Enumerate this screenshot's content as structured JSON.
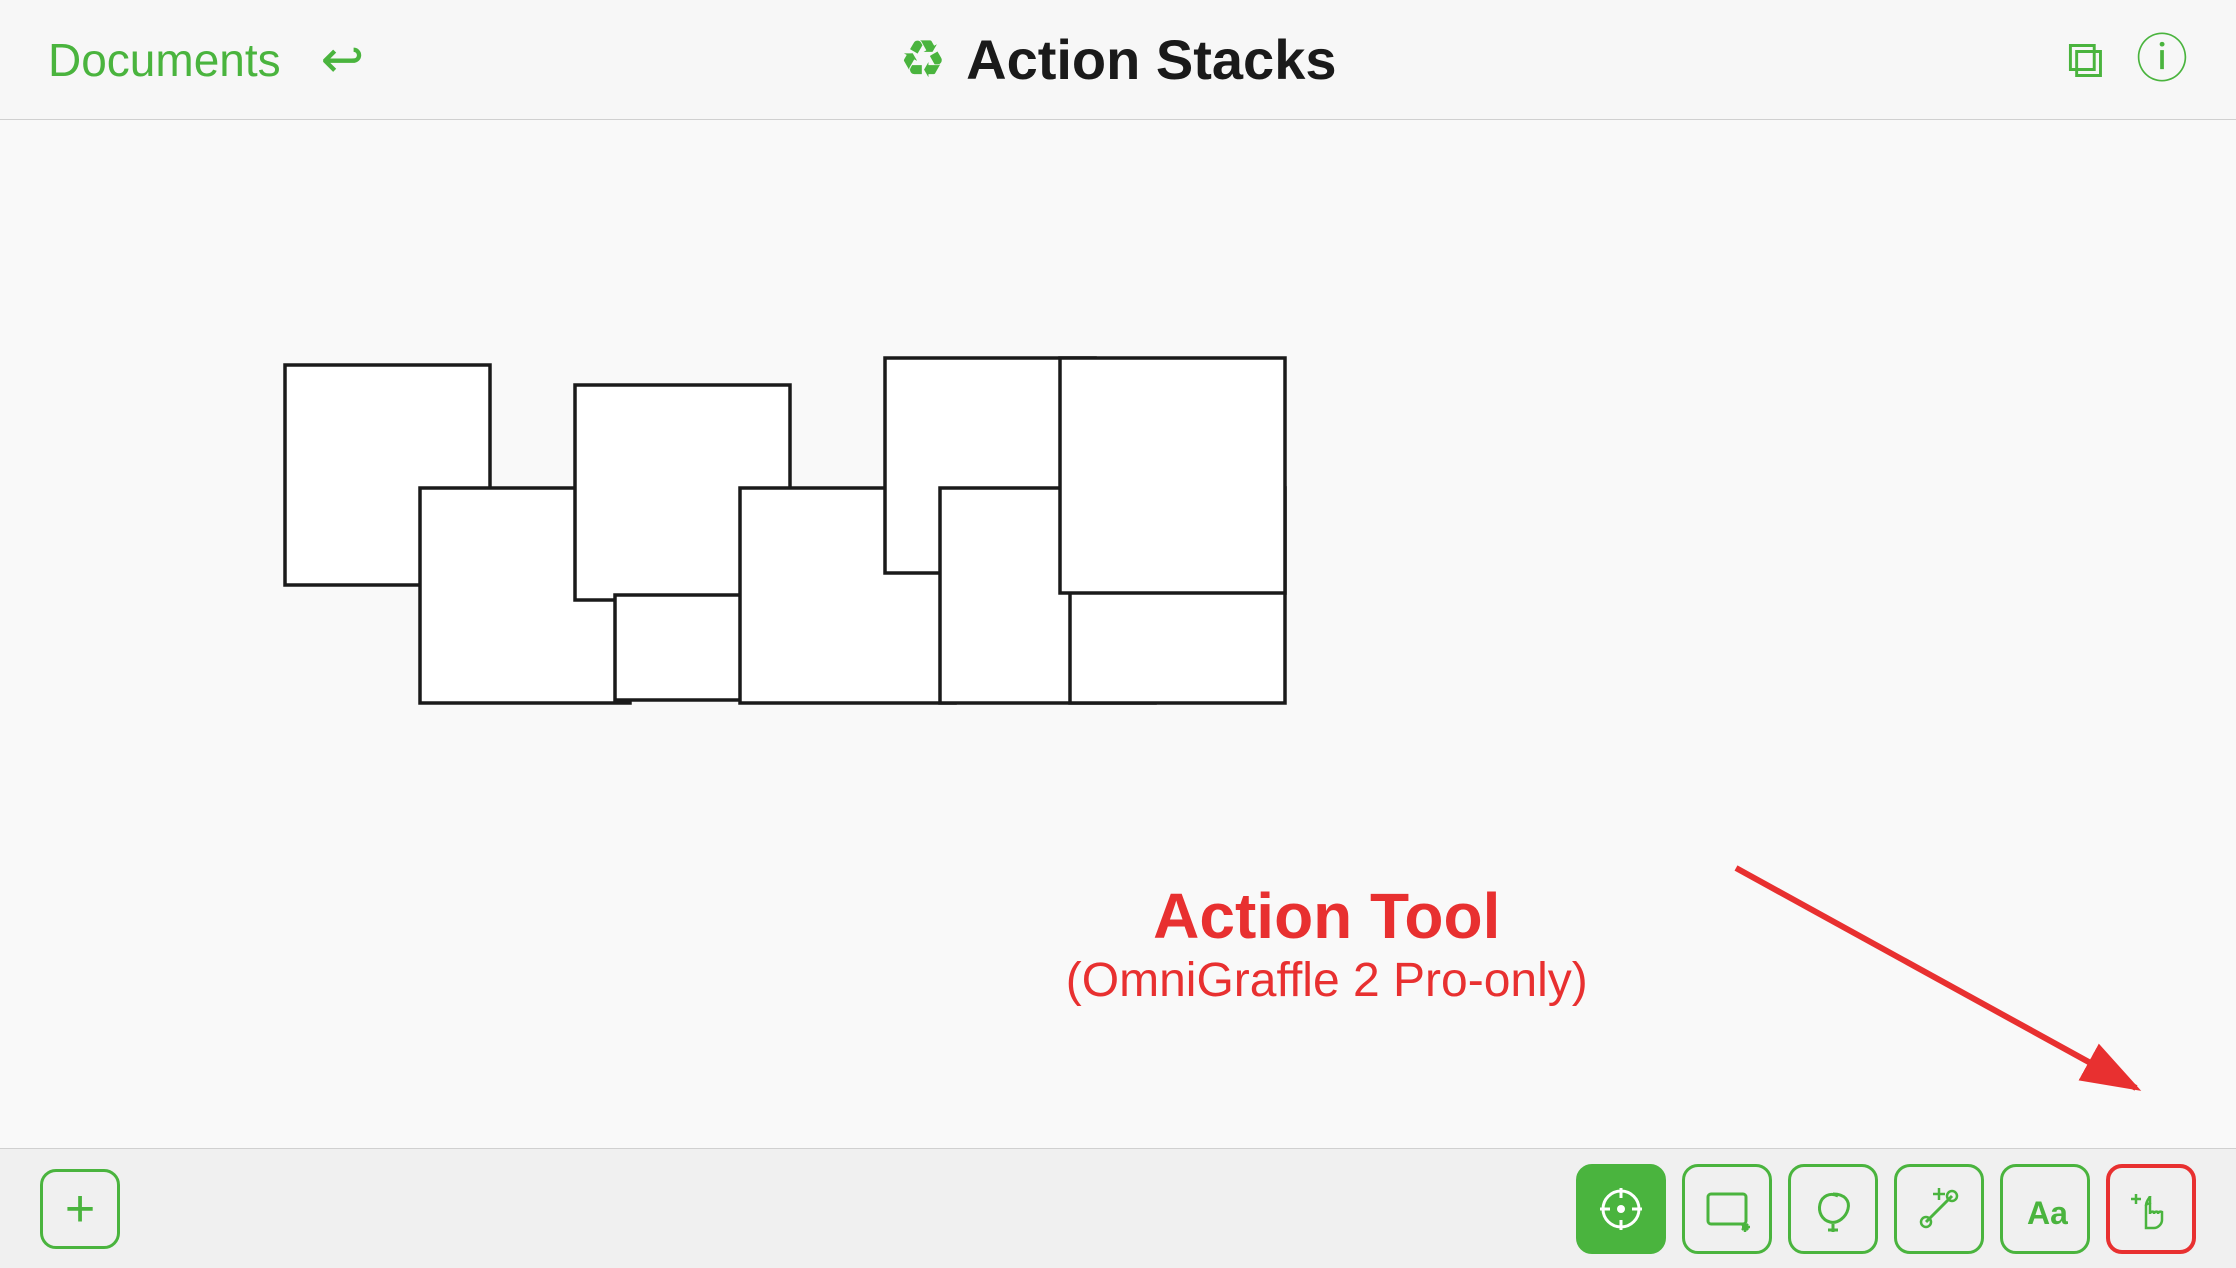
{
  "header": {
    "documents_label": "Documents",
    "title": "Action Stacks",
    "back_icon": "↩",
    "title_icon": "♻",
    "duplicate_icon": "⧉",
    "info_icon": "ⓘ"
  },
  "annotation": {
    "title": "Action Tool",
    "subtitle": "(OmniGraffle 2 Pro-only)"
  },
  "toolbar": {
    "add_label": "+",
    "tools": [
      {
        "id": "select",
        "label": "⊕",
        "active": true
      },
      {
        "id": "shape",
        "label": "▭",
        "active": false
      },
      {
        "id": "freehand",
        "label": "↺",
        "active": false
      },
      {
        "id": "connect",
        "label": "✛",
        "active": false
      },
      {
        "id": "text",
        "label": "Aa",
        "active": false
      },
      {
        "id": "action",
        "label": "☛",
        "active": false,
        "highlighted": true
      }
    ]
  },
  "colors": {
    "green": "#4ab43e",
    "red": "#e83030",
    "border": "#1a1a1a"
  }
}
